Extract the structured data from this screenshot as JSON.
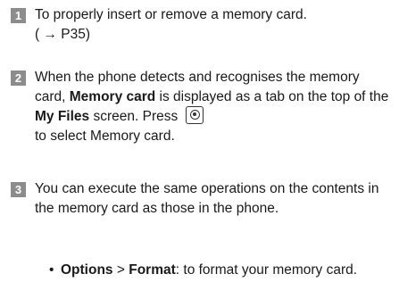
{
  "steps": [
    {
      "number": "1",
      "line1": "To properly insert or remove a memory card.",
      "line2": "( → P35)"
    },
    {
      "number": "2",
      "part1": "When the phone detects and recognises the memory card, ",
      "bold1": "Memory card",
      "part2": " is displayed as a tab on the top of the ",
      "bold2": "My Files",
      "part3": " screen. Press ",
      "key_icon": "center-key-icon",
      "part4": " to select Memory card."
    },
    {
      "number": "3",
      "text": "You can execute the same operations on the contents in the memory card as those in the phone."
    }
  ],
  "bullet": {
    "symbol": "•",
    "bold1": "Options",
    "sep": " > ",
    "bold2": "Format",
    "rest": ": to format your memory card."
  },
  "colors": {
    "badge_bg": "#8c8c8c",
    "text": "#1a1a1a"
  }
}
